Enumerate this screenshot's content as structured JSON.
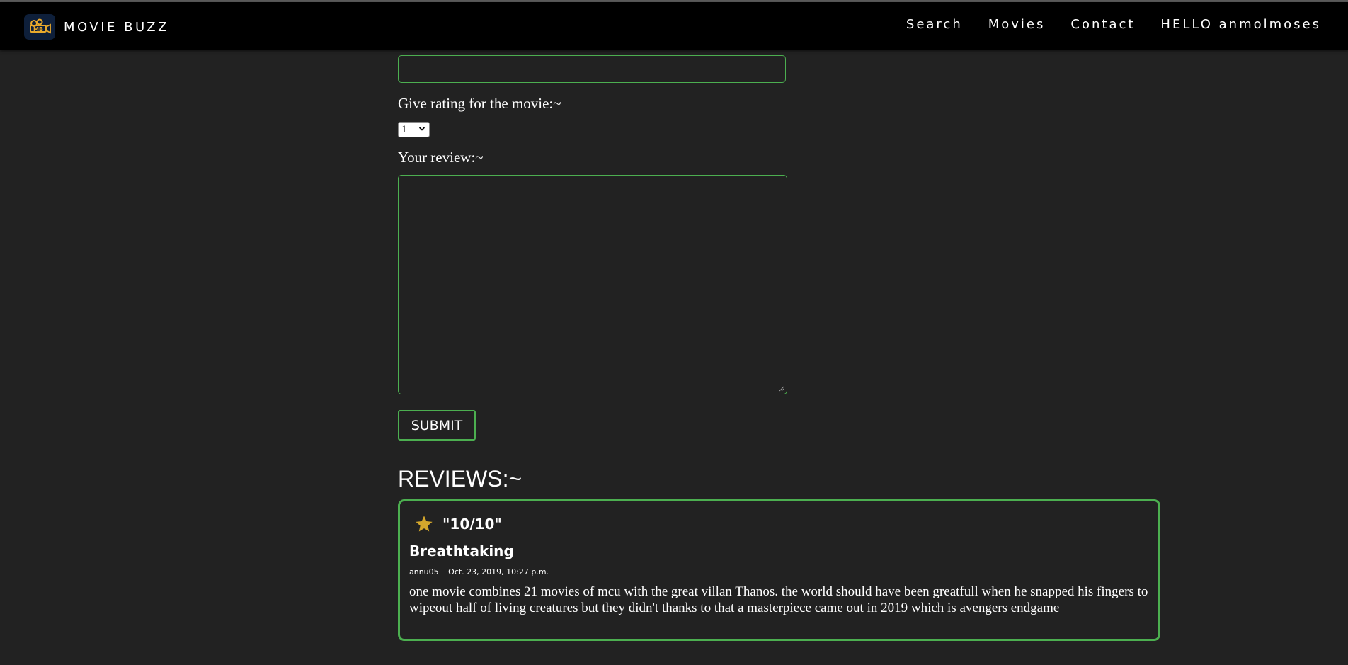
{
  "navbar": {
    "brand_name": "MOVIE BUZZ",
    "logo_icon": "movie-buzz-logo",
    "links": {
      "search": "Search",
      "movies": "Movies",
      "contact": "Contact",
      "user_greeting": "HELLO anmolmoses"
    }
  },
  "form": {
    "title_input_value": "",
    "rating_label": "Give rating for the movie:~",
    "rating_selected": "1",
    "review_label": "Your review:~",
    "review_value": "",
    "submit_label": "SUBMIT"
  },
  "reviews": {
    "heading": "REVIEWS:~",
    "items": [
      {
        "score": "\"10/10\"",
        "title": "Breathtaking",
        "author": "annu05",
        "date": "Oct. 23, 2019, 10:27 p.m.",
        "body": "one movie combines 21 movies of mcu with the great villan Thanos. the world should have been greatfull when he snapped his fingers to wipeout half of living creatures but they didn't thanks to that a masterpiece came out in 2019 which is avengers endgame"
      }
    ]
  },
  "colors": {
    "background": "#222222",
    "navbar": "#000000",
    "accent_green": "#4caf50",
    "star_gold": "#d4a72c"
  }
}
